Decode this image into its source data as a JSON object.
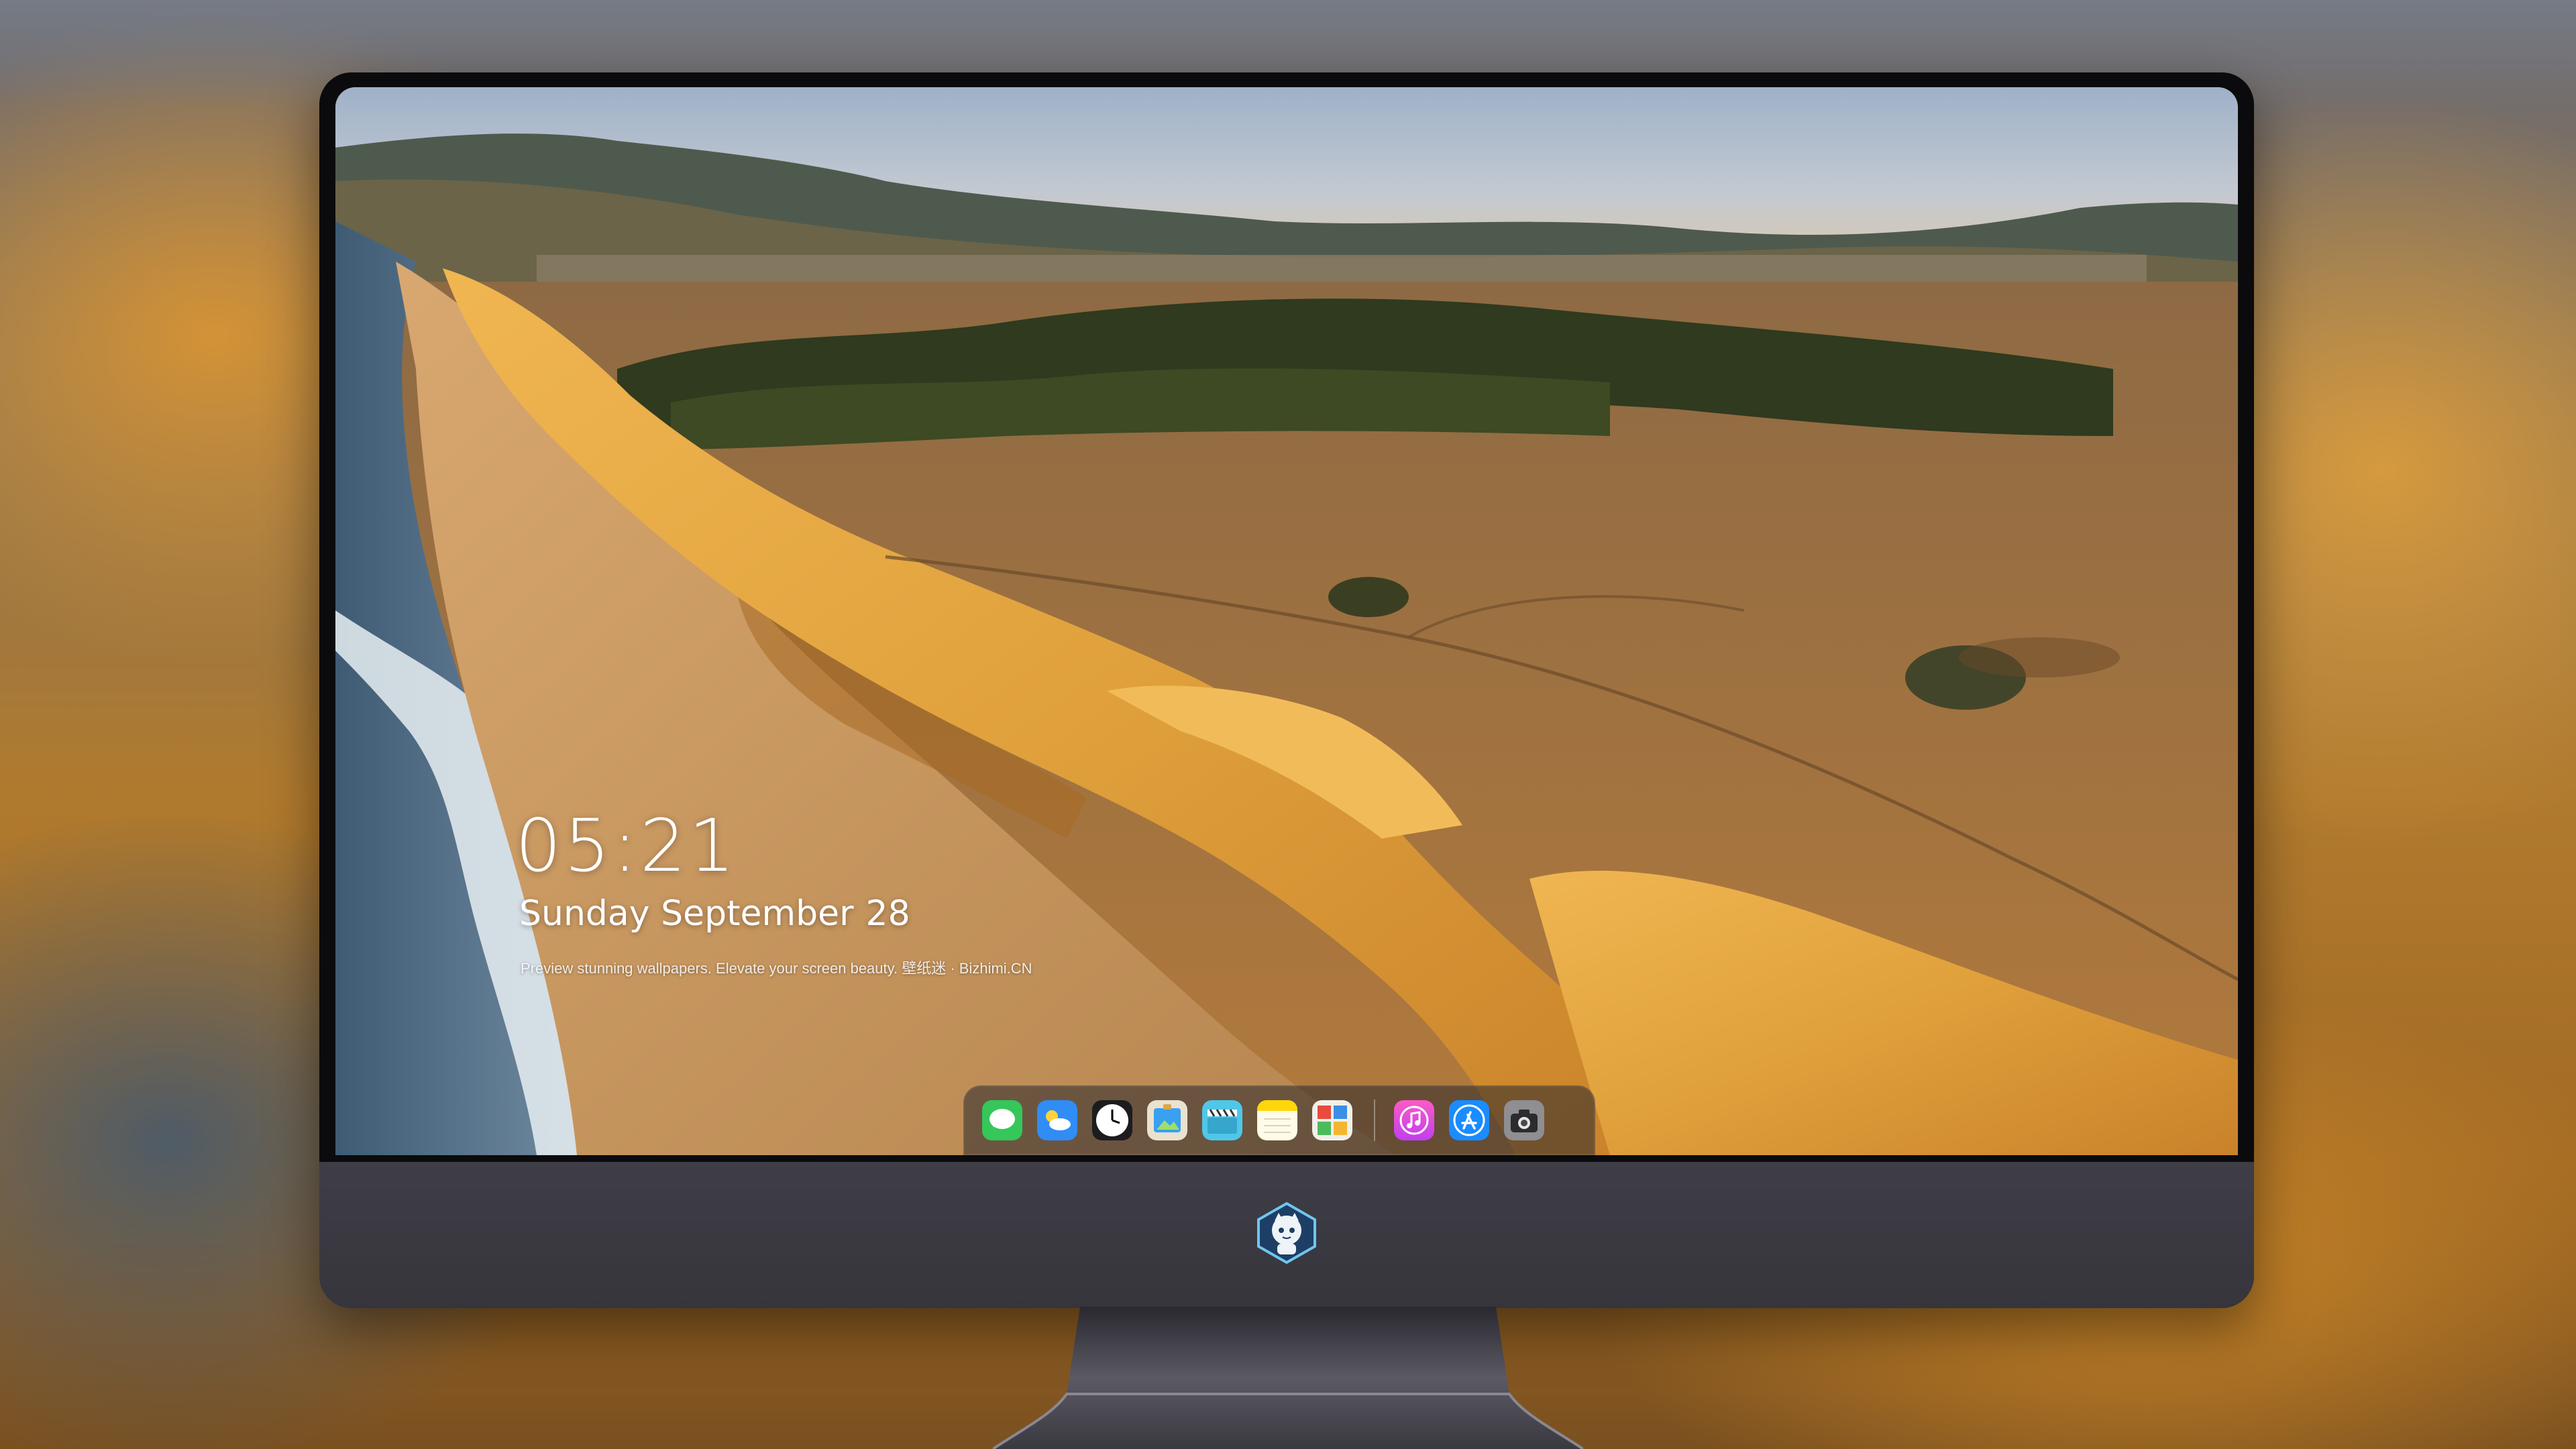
{
  "lockscreen": {
    "time": "05:21",
    "weekday_month": "Sunday September",
    "day": "28",
    "caption": "Preview stunning wallpapers. Elevate your screen beauty. 壁纸迷 · Bizhimi.CN"
  },
  "dock": {
    "apps": [
      {
        "icon": "messages-icon",
        "color": "#35c759"
      },
      {
        "icon": "weather-icon",
        "color": "#2f8df5"
      },
      {
        "icon": "clock-icon",
        "color": "#ffffff"
      },
      {
        "icon": "preview-icon",
        "color": "#3aa0f0"
      },
      {
        "icon": "clips-icon",
        "color": "#4fc7e8"
      },
      {
        "icon": "notes-icon",
        "color": "#ffd60a"
      },
      {
        "icon": "photo-booth-icon",
        "color": "#e84b3c"
      },
      {
        "icon": "music-icon",
        "color": "#fb5bc5"
      },
      {
        "icon": "app-store-icon",
        "color": "#1a8cff"
      },
      {
        "icon": "camera-icon",
        "color": "#8e8e93"
      }
    ]
  },
  "colors": {
    "bezel": "#0b0b0d",
    "chin": "#3a3840",
    "sky": "#a9b8cc",
    "cliff": "#e3a23e",
    "ocean": "#4c6a82"
  }
}
